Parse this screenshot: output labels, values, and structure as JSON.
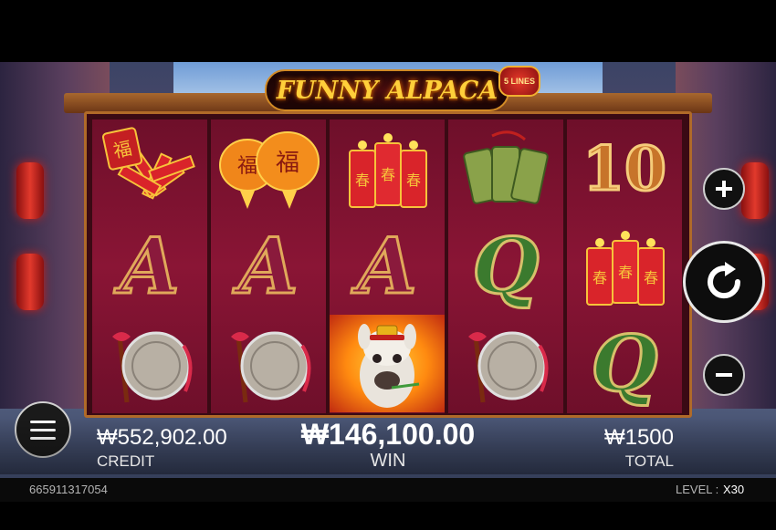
{
  "game": {
    "title": "FUNNY ALPACA",
    "lines_badge": "5 LINES"
  },
  "reels": [
    {
      "symbols": [
        "firecracker-bundle",
        "A",
        "gong"
      ],
      "labels": [
        "",
        "A",
        ""
      ]
    },
    {
      "symbols": [
        "lucky-lanterns",
        "A",
        "gong"
      ],
      "labels": [
        "",
        "A",
        ""
      ]
    },
    {
      "symbols": [
        "firecrackers-chun",
        "A",
        "alpaca-wild"
      ],
      "labels": [
        "",
        "A",
        ""
      ]
    },
    {
      "symbols": [
        "jade-plaques",
        "Q",
        "gong"
      ],
      "labels": [
        "",
        "Q",
        ""
      ]
    },
    {
      "symbols": [
        "10",
        "firecrackers-chun",
        "Q"
      ],
      "labels": [
        "10",
        "",
        "Q"
      ]
    }
  ],
  "hud": {
    "credit_value": "₩552,902.00",
    "credit_label": "CREDIT",
    "win_value": "₩146,100.00",
    "win_label": "WIN",
    "total_value": "₩1500",
    "total_label": "TOTAL"
  },
  "controls": {
    "plus_icon": "plus-icon",
    "minus_icon": "minus-icon",
    "spin_icon": "refresh-icon",
    "menu_icon": "hamburger-icon"
  },
  "footer": {
    "session_id": "665911317054",
    "level_label": "LEVEL :",
    "level_value": "X30"
  },
  "colors": {
    "accent_gold": "#ffcf3a",
    "reel_bg": "#8a1535",
    "frame": "#b06a28"
  }
}
